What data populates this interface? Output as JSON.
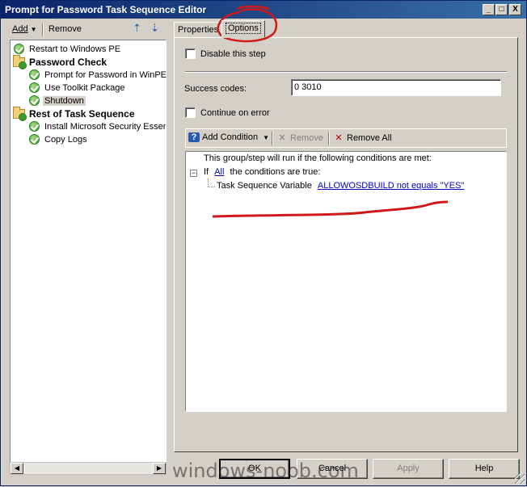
{
  "window": {
    "title": "Prompt for Password Task Sequence Editor",
    "controls": {
      "minimize": "_",
      "maximize": "□",
      "close": "X"
    }
  },
  "left_toolbar": {
    "add_label": "Add",
    "remove_label": "Remove"
  },
  "tree": {
    "items": [
      {
        "label": "Restart to Windows PE",
        "type": "step",
        "level": 0
      },
      {
        "label": "Password Check",
        "type": "group",
        "level": 0
      },
      {
        "label": "Prompt for Password in WinPE",
        "type": "step",
        "level": 1
      },
      {
        "label": "Use Toolkit Package",
        "type": "step",
        "level": 1
      },
      {
        "label": "Shutdown",
        "type": "step",
        "level": 1,
        "selected": true
      },
      {
        "label": "Rest of Task Sequence",
        "type": "group",
        "level": 0
      },
      {
        "label": "Install Microsoft Security Essen",
        "type": "step",
        "level": 1
      },
      {
        "label": "Copy Logs",
        "type": "step",
        "level": 1
      }
    ]
  },
  "tabs": [
    {
      "label": "Properties"
    },
    {
      "label": "Options",
      "active": true
    }
  ],
  "options": {
    "disable_step_label": "Disable this step",
    "success_codes_label": "Success codes:",
    "success_codes_value": "0 3010",
    "continue_on_error_label": "Continue on error",
    "toolbar": {
      "add_condition": "Add Condition",
      "remove": "Remove",
      "remove_all": "Remove All"
    },
    "conditions": {
      "header": "This group/step will run if the following conditions are met:",
      "if_label": "If",
      "all_link": "All",
      "if_suffix": "the conditions are true:",
      "variable_prefix": "Task Sequence Variable",
      "variable_link": "ALLOWOSDBUILD not equals \"YES\""
    }
  },
  "buttons": {
    "ok": "OK",
    "cancel": "Cancel",
    "apply": "Apply",
    "help": "Help"
  },
  "watermark": "windows-noob.com",
  "colors": {
    "title_bar": "#0a246a",
    "annotation_red": "#d01818",
    "link": "#0000cc"
  }
}
